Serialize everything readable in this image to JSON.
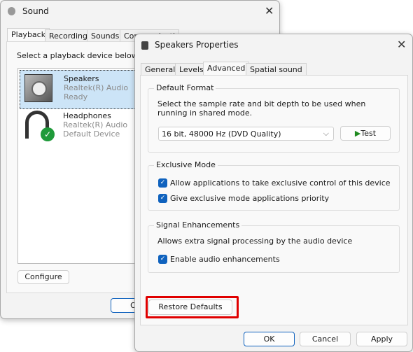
{
  "sound_window": {
    "title": "Sound",
    "tabs": [
      "Playback",
      "Recording",
      "Sounds",
      "Communications"
    ],
    "instruction": "Select a playback device below to modify its settings:",
    "devices": [
      {
        "name": "Speakers",
        "driver": "Realtek(R) Audio",
        "status": "Ready",
        "selected": true,
        "icon": "speaker-icon"
      },
      {
        "name": "Headphones",
        "driver": "Realtek(R) Audio",
        "status": "Default Device",
        "icon": "headphones-icon",
        "badge": "default-check-icon"
      }
    ],
    "configure_label": "Configure",
    "ok_label": "OK"
  },
  "props_window": {
    "title": "Speakers Properties",
    "tabs": [
      "General",
      "Levels",
      "Advanced",
      "Spatial sound"
    ],
    "active_tab": "Advanced",
    "default_format": {
      "label": "Default Format",
      "description": "Select the sample rate and bit depth to be used when running in shared mode.",
      "selected": "16 bit, 48000 Hz (DVD Quality)",
      "test_label": "Test"
    },
    "exclusive": {
      "label": "Exclusive Mode",
      "options": [
        {
          "label": "Allow applications to take exclusive control of this device",
          "checked": true
        },
        {
          "label": "Give exclusive mode applications priority",
          "checked": true
        }
      ]
    },
    "signal": {
      "label": "Signal Enhancements",
      "description": "Allows extra signal processing by the audio device",
      "option": {
        "label": "Enable audio enhancements",
        "checked": true
      }
    },
    "restore_label": "Restore Defaults",
    "ok_label": "OK",
    "cancel_label": "Cancel",
    "apply_label": "Apply",
    "highlight_color": "#e00000"
  }
}
